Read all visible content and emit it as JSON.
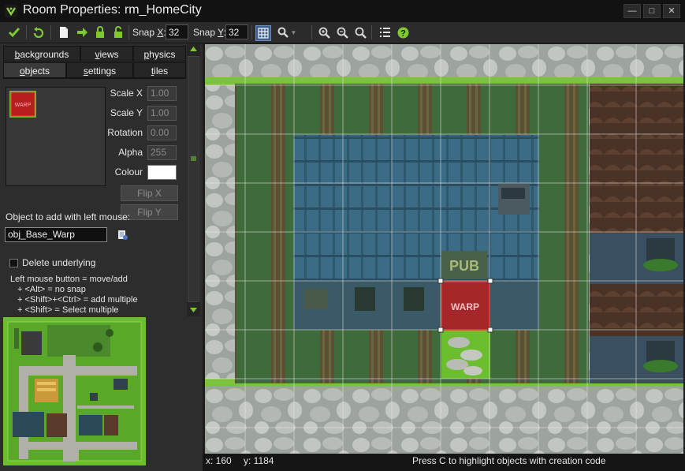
{
  "window": {
    "title": "Room Properties: rm_HomeCity"
  },
  "toolbar": {
    "snap_x_label": "Snap X:",
    "snap_x_value": "32",
    "snap_y_label": "Snap Y:",
    "snap_y_value": "32"
  },
  "tabs": {
    "row1": [
      "backgrounds",
      "views",
      "physics"
    ],
    "row2": [
      "objects",
      "settings",
      "tiles"
    ]
  },
  "object_props": {
    "scale_x_label": "Scale X",
    "scale_x_value": "1.00",
    "scale_y_label": "Scale Y",
    "scale_y_value": "1.00",
    "rotation_label": "Rotation",
    "rotation_value": "0.00",
    "alpha_label": "Alpha",
    "alpha_value": "255",
    "colour_label": "Colour",
    "colour_value": "#ffffff",
    "flip_x_label": "Flip X",
    "flip_y_label": "Flip Y"
  },
  "object_select": {
    "label": "Object to add with left mouse:",
    "value": "obj_Base_Warp"
  },
  "delete_underlying": {
    "label": "Delete underlying",
    "checked": false
  },
  "help_text": [
    "Left mouse button = move/add",
    "+ <Alt> = no snap",
    "+ <Shift>+<Ctrl> = add multiple",
    "+ <Shift> = Select multiple"
  ],
  "preview": {
    "sprite_text": "WARP"
  },
  "room": {
    "pub_sign": "PUB",
    "selected_object_label": "WARP"
  },
  "status": {
    "x": "x: 160",
    "y": "y: 1184",
    "message": "Press C to highlight objects with creation code"
  },
  "colors": {
    "accent_green": "#7ec832",
    "warp_red": "#b81e1e",
    "grass": "#6bbf2e",
    "roof_blue": "#3a6a86",
    "cobble": "#a8aca8"
  },
  "icons": [
    "check-icon",
    "undo-icon",
    "new-doc-icon",
    "arrow-right-icon",
    "lock-icon",
    "unlock-icon",
    "grid-icon",
    "magnifier-icon",
    "zoom-in-icon",
    "zoom-out-icon",
    "zoom-reset-icon",
    "list-icon",
    "help-icon",
    "object-menu-icon"
  ]
}
